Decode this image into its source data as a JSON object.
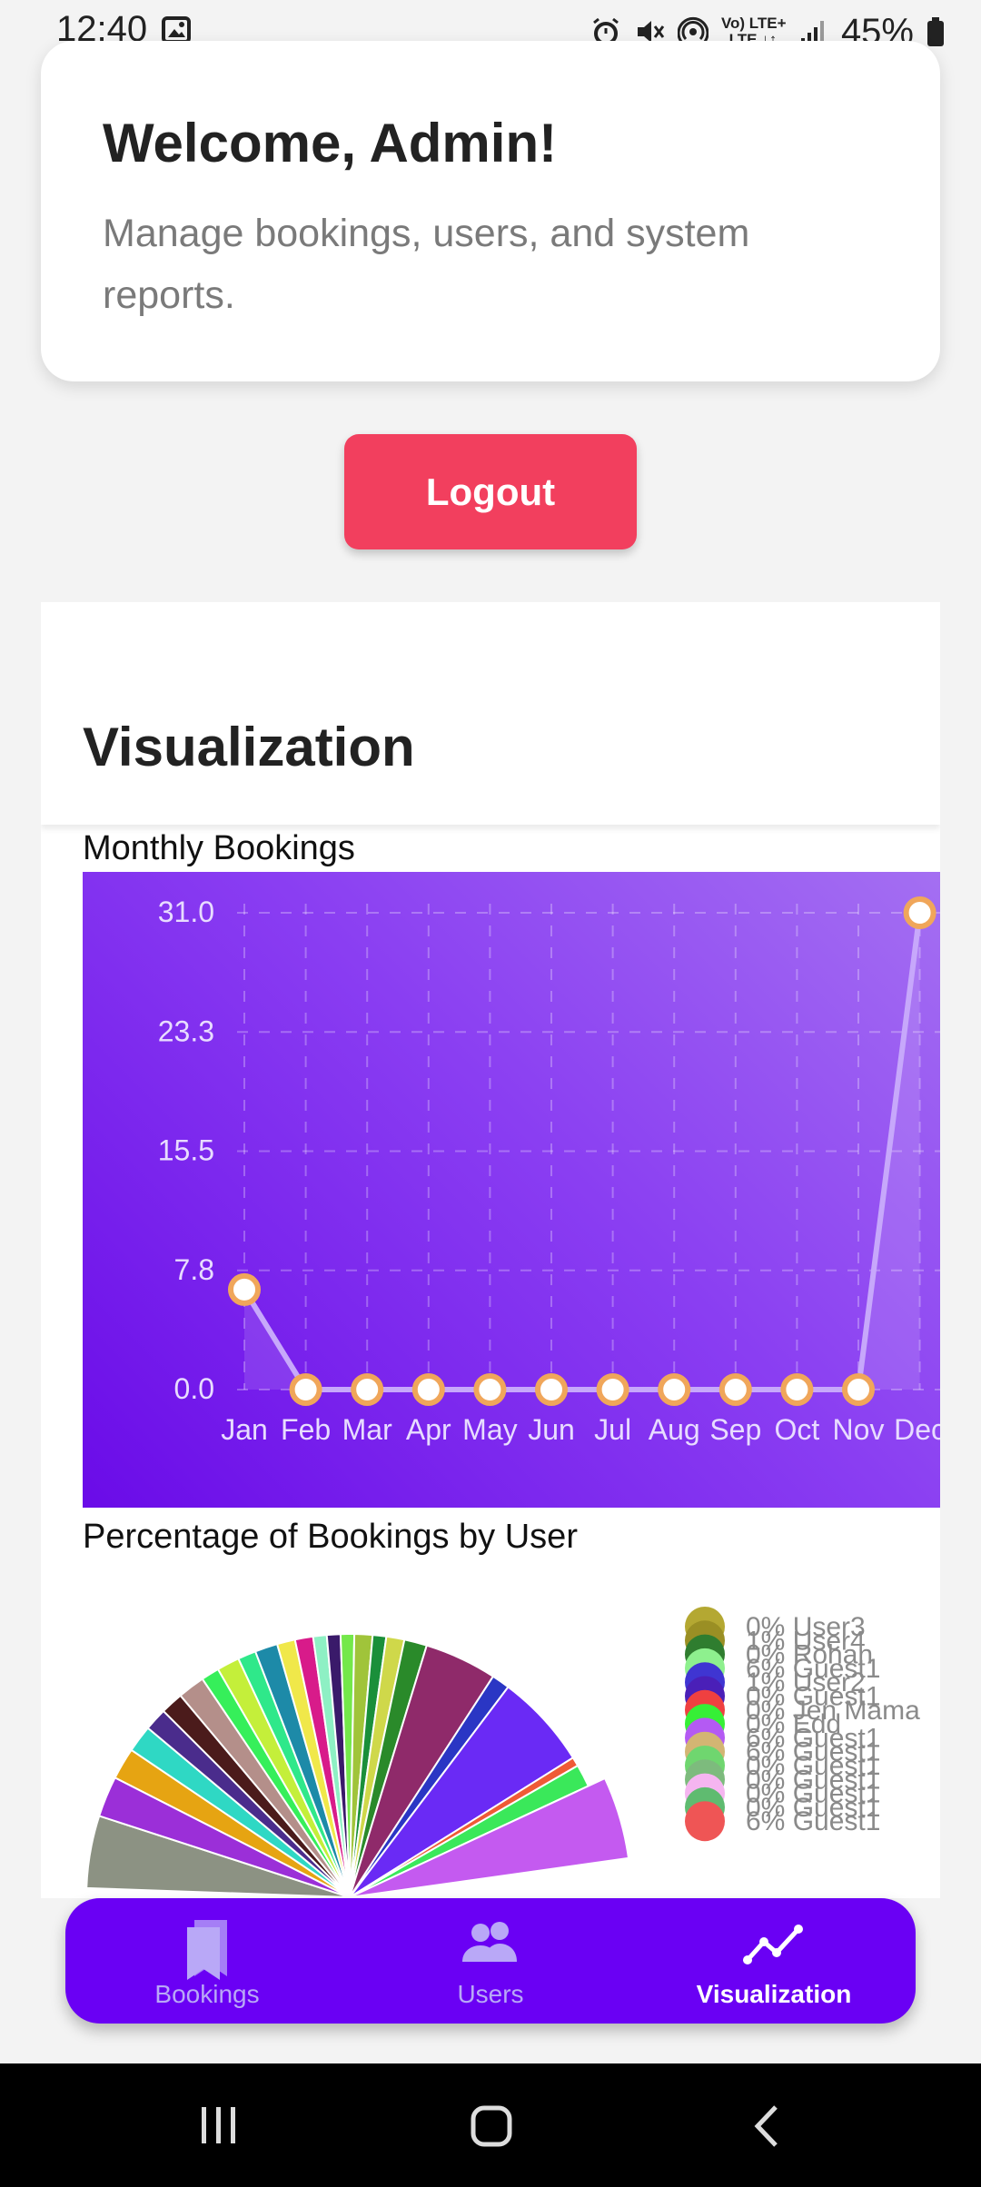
{
  "status_bar": {
    "time": "12:40",
    "lte_label": "Vo) LTE+\nLTE ↓↑",
    "battery": "45%"
  },
  "welcome_card": {
    "title": "Welcome, Admin!",
    "subtitle": "Manage bookings, users, and system reports."
  },
  "logout_button": {
    "label": "Logout"
  },
  "visualization": {
    "section_title": "Visualization"
  },
  "monthly_chart": {
    "title": "Monthly Bookings",
    "y_tick_labels": [
      "31.0",
      "23.3",
      "15.5",
      "7.8",
      "0.0"
    ]
  },
  "user_chart": {
    "title": "Percentage of Bookings by User",
    "legend_labels": [
      "0% User3",
      "1% User4",
      "0% Rohan",
      "6% Guest1",
      "1% User2",
      "0% Guest1",
      "0% Jen Mama",
      "0% Edd",
      "6% Guest1",
      "6% Guest1",
      "0% Guest1",
      "0% Guest1",
      "0% Guest1",
      "0% Guest1",
      "6% Guest1"
    ]
  },
  "chart_data": [
    {
      "type": "line",
      "title": "Monthly Bookings",
      "categories": [
        "Jan",
        "Feb",
        "Mar",
        "Apr",
        "May",
        "Jun",
        "Jul",
        "Aug",
        "Sep",
        "Oct",
        "Nov",
        "Dec"
      ],
      "values": [
        6.5,
        0,
        0,
        0,
        0,
        0,
        0,
        0,
        0,
        0,
        0,
        31
      ],
      "ylim": [
        0,
        31
      ],
      "grid": true,
      "colors": {
        "line": "#c7a8fb",
        "point_fill": "#ffffff",
        "point_stroke": "#f0a65a"
      }
    },
    {
      "type": "pie",
      "title": "Percentage of Bookings by User",
      "legend_position": "right",
      "legend_colors": [
        "#b4a832",
        "#9a8f24",
        "#2f7d2f",
        "#8ef08e",
        "#3f35d2",
        "#4a1fb8",
        "#ef4040",
        "#36ef36",
        "#b45af3",
        "#d3b573",
        "#6fd66f",
        "#7dbb7d",
        "#f5b5f0",
        "#5fbb70",
        "#ef5555"
      ],
      "slice_colors": [
        "#8c9283",
        "#9b2fd8",
        "#e6a412",
        "#2fd8c4",
        "#4a2c8c",
        "#4b1b1b",
        "#b48f8a",
        "#36ef5a",
        "#c4ef3a",
        "#2fe88a",
        "#1d8aa8",
        "#f0e84a",
        "#d81b8a",
        "#8ef0c4",
        "#3a1a6a",
        "#74e84a",
        "#a0c43a",
        "#1a8f3a",
        "#cfd84a",
        "#2a8a2a",
        "#8f2a6a",
        "#2a36c4",
        "#6a2af5",
        "#ef5a36",
        "#3ae85a",
        "#c45af0"
      ]
    }
  ]
}
